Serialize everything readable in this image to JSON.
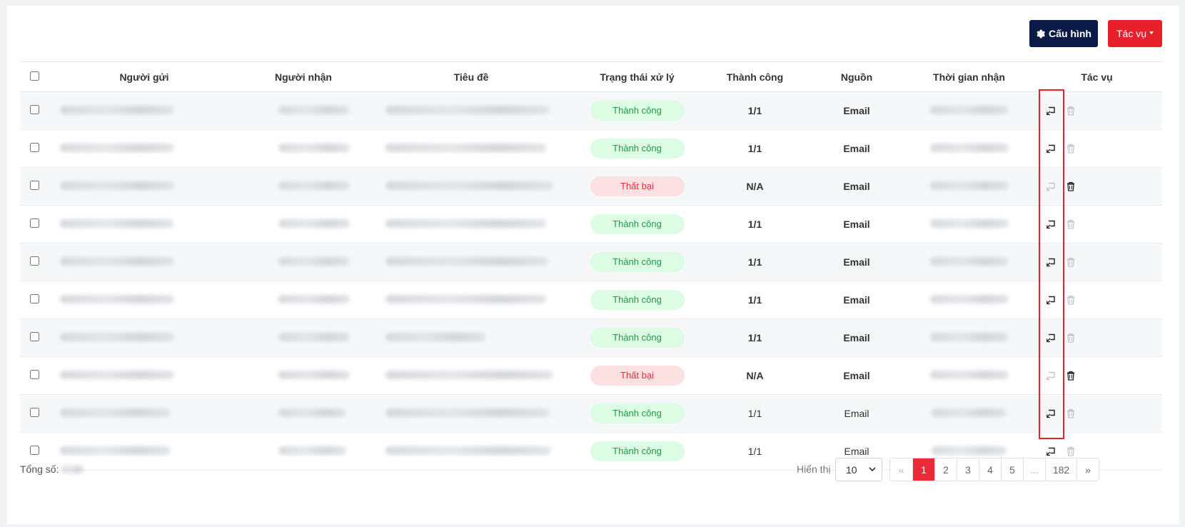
{
  "toolbar": {
    "config_label": "Cấu hình",
    "actions_label": "Tác vụ"
  },
  "table": {
    "columns": [
      "Người gửi",
      "Người nhận",
      "Tiêu đề",
      "Trạng thái xử lý",
      "Thành công",
      "Nguồn",
      "Thời gian nhận",
      "Tác vụ"
    ],
    "rows": [
      {
        "status": "Thành công",
        "status_type": "ok",
        "success": "1/1",
        "source": "Email",
        "bold": true
      },
      {
        "status": "Thành công",
        "status_type": "ok",
        "success": "1/1",
        "source": "Email",
        "bold": true
      },
      {
        "status": "Thất bại",
        "status_type": "fail",
        "success": "N/A",
        "source": "Email",
        "bold": true
      },
      {
        "status": "Thành công",
        "status_type": "ok",
        "success": "1/1",
        "source": "Email",
        "bold": true
      },
      {
        "status": "Thành công",
        "status_type": "ok",
        "success": "1/1",
        "source": "Email",
        "bold": true
      },
      {
        "status": "Thành công",
        "status_type": "ok",
        "success": "1/1",
        "source": "Email",
        "bold": true
      },
      {
        "status": "Thành công",
        "status_type": "ok",
        "success": "1/1",
        "source": "Email",
        "bold": true
      },
      {
        "status": "Thất bại",
        "status_type": "fail",
        "success": "N/A",
        "source": "Email",
        "bold": true
      },
      {
        "status": "Thành công",
        "status_type": "ok",
        "success": "1/1",
        "source": "Email",
        "bold": false
      },
      {
        "status": "Thành công",
        "status_type": "ok",
        "success": "1/1",
        "source": "Email",
        "bold": false
      }
    ]
  },
  "footer": {
    "total_label": "Tổng số:",
    "show_label": "Hiển thị",
    "page_size": "10",
    "pages": [
      "«",
      "1",
      "2",
      "3",
      "4",
      "5",
      "...",
      "182",
      "»"
    ],
    "active_page": "1"
  },
  "colors": {
    "primary_dark": "#0b1b48",
    "danger": "#e8202c",
    "success_bg": "#dcfce3",
    "success_text": "#1e9c4a",
    "fail_bg": "#fde0e2",
    "fail_text": "#e0303c"
  },
  "icons": {
    "config": "gear-icon",
    "reprocess": "reply-icon",
    "delete": "trash-icon"
  }
}
